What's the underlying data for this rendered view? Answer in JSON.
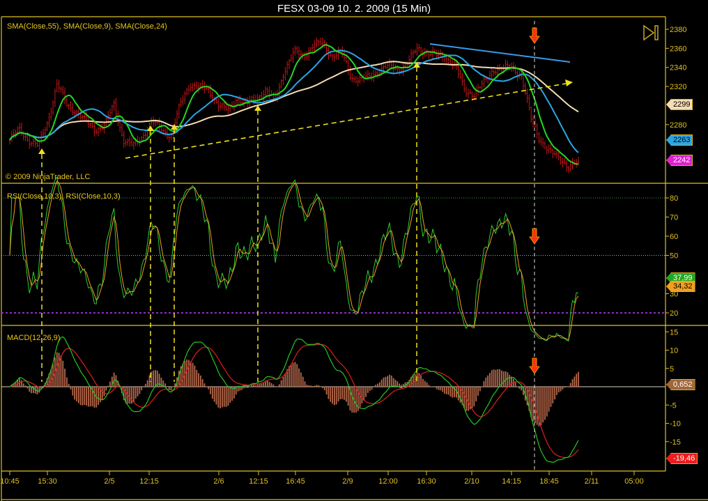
{
  "window": {
    "title": "FESX 03-09  10. 2. 2009 (15 Min)"
  },
  "copyright": "© 2009 NinjaTrader, LLC",
  "colors": {
    "frame": "#e0c020",
    "bars": "#c81818",
    "sma55": "#f5dcb4",
    "sma9": "#22d822",
    "sma24": "#2aa6e6",
    "rsi": "#2ecc2e",
    "rsi_avg": "#f0a020",
    "macd": "#22c822",
    "macd_signal": "#dd2020",
    "macd_hist": "#b8684a",
    "trend_up": "#f0e020",
    "trend_down": "#3a9ae8",
    "signal_arrow": "#ff3010"
  },
  "icons": {
    "autoscroll": "play-to-end-icon",
    "signal": "red-down-arrow-icon",
    "entry": "yellow-up-arrow-icon"
  },
  "chart_data": {
    "type": "line",
    "x_ticks": [
      "10:45",
      "15:30",
      "2/5",
      "12:15",
      "2/6",
      "12:15",
      "16:45",
      "2/9",
      "12:00",
      "16:30",
      "2/10",
      "14:15",
      "18:45",
      "2/11",
      "05:00"
    ],
    "panels": [
      {
        "name": "price",
        "label": "SMA(Close,55), SMA(Close,9), SMA(Close,24)",
        "series_type": "ohlc",
        "close": [
          2264,
          2275,
          2264,
          2257,
          2283,
          2323,
          2301,
          2294,
          2283,
          2275,
          2279,
          2301,
          2264,
          2257,
          2268,
          2283,
          2275,
          2268,
          2301,
          2323,
          2319,
          2316,
          2301,
          2294,
          2308,
          2301,
          2308,
          2316,
          2305,
          2338,
          2356,
          2352,
          2363,
          2365,
          2352,
          2356,
          2330,
          2327,
          2330,
          2338,
          2341,
          2338,
          2345,
          2360,
          2356,
          2352,
          2352,
          2341,
          2316,
          2312,
          2323,
          2338,
          2338,
          2341,
          2330,
          2286,
          2264,
          2250,
          2246,
          2235,
          2241
        ],
        "ylim": [
          2230,
          2385
        ],
        "y_ticks": [
          2280,
          2300,
          2320,
          2340,
          2360,
          2380
        ],
        "y_tick_labels": [
          "2280",
          "2320",
          "2340",
          "2360",
          "2380"
        ],
        "last_values": [
          {
            "text": "2299",
            "bg": "#f5dcb4",
            "fg": "#000"
          },
          {
            "text": "2263",
            "bg": "#2aa6e6",
            "fg": "#000"
          },
          {
            "text": "2242",
            "bg": "#e020d0",
            "fg": "#fff"
          }
        ]
      },
      {
        "name": "rsi",
        "label": "RSI(Close,10,3), RSI(Close,10,3)",
        "ylim": [
          15,
          87
        ],
        "y_tick_labels": [
          "20",
          "30",
          "50",
          "60",
          "70",
          "80"
        ],
        "levels": [
          {
            "value": 80,
            "color": "#22aa44"
          },
          {
            "value": 50,
            "color": "#66cccc"
          },
          {
            "value": 20,
            "color": "#9030c0"
          }
        ],
        "last_values": [
          {
            "text": "37,99",
            "bg": "#22a822",
            "fg": "#fff"
          },
          {
            "text": "34,32",
            "bg": "#f0a020",
            "fg": "#000"
          }
        ]
      },
      {
        "name": "macd",
        "label": "MACD(12,26,9)",
        "ylim": [
          -22,
          17
        ],
        "y_tick_labels": [
          "15",
          "10",
          "5",
          "-5",
          "-10",
          "-15"
        ],
        "last_values": [
          {
            "text": "0,652",
            "bg": "#a06838",
            "fg": "#fff"
          },
          {
            "text": "-19,46",
            "bg": "#ee1c1c",
            "fg": "#fff"
          }
        ]
      }
    ]
  }
}
